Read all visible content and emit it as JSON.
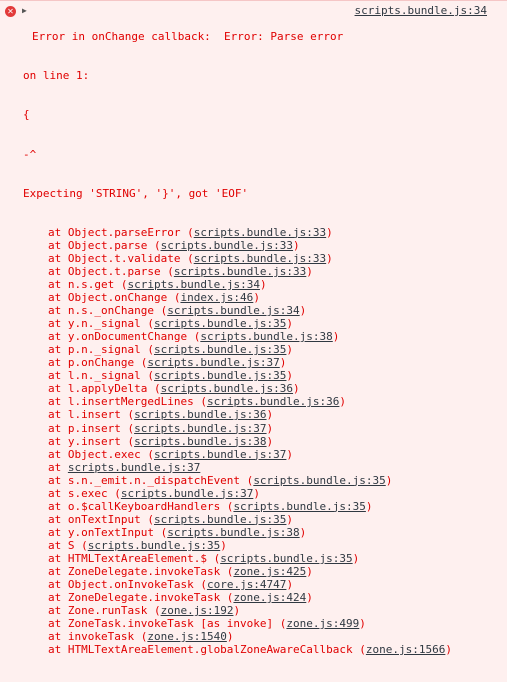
{
  "entry": {
    "icon": "error-icon",
    "expand_icon": "triangle-right-icon",
    "error_title": "Error in onChange callback:  Error: Parse error ",
    "source": "scripts.bundle.js:34",
    "message_lines": [
      "on line 1:",
      "{",
      "-^",
      "Expecting 'STRING', '}', got 'EOF'"
    ],
    "frames": [
      {
        "prefix": "at Object.parseError (",
        "loc": "scripts.bundle.js:33",
        "suffix": ")"
      },
      {
        "prefix": "at Object.parse (",
        "loc": "scripts.bundle.js:33",
        "suffix": ")"
      },
      {
        "prefix": "at Object.t.validate (",
        "loc": "scripts.bundle.js:33",
        "suffix": ")"
      },
      {
        "prefix": "at Object.t.parse (",
        "loc": "scripts.bundle.js:33",
        "suffix": ")"
      },
      {
        "prefix": "at n.s.get (",
        "loc": "scripts.bundle.js:34",
        "suffix": ")"
      },
      {
        "prefix": "at Object.onChange (",
        "loc": "index.js:46",
        "suffix": ")"
      },
      {
        "prefix": "at n.s._onChange (",
        "loc": "scripts.bundle.js:34",
        "suffix": ")"
      },
      {
        "prefix": "at y.n._signal (",
        "loc": "scripts.bundle.js:35",
        "suffix": ")"
      },
      {
        "prefix": "at y.onDocumentChange (",
        "loc": "scripts.bundle.js:38",
        "suffix": ")"
      },
      {
        "prefix": "at p.n._signal (",
        "loc": "scripts.bundle.js:35",
        "suffix": ")"
      },
      {
        "prefix": "at p.onChange (",
        "loc": "scripts.bundle.js:37",
        "suffix": ")"
      },
      {
        "prefix": "at l.n._signal (",
        "loc": "scripts.bundle.js:35",
        "suffix": ")"
      },
      {
        "prefix": "at l.applyDelta (",
        "loc": "scripts.bundle.js:36",
        "suffix": ")"
      },
      {
        "prefix": "at l.insertMergedLines (",
        "loc": "scripts.bundle.js:36",
        "suffix": ")"
      },
      {
        "prefix": "at l.insert (",
        "loc": "scripts.bundle.js:36",
        "suffix": ")"
      },
      {
        "prefix": "at p.insert (",
        "loc": "scripts.bundle.js:37",
        "suffix": ")"
      },
      {
        "prefix": "at y.insert (",
        "loc": "scripts.bundle.js:38",
        "suffix": ")"
      },
      {
        "prefix": "at Object.exec (",
        "loc": "scripts.bundle.js:37",
        "suffix": ")"
      },
      {
        "prefix": "at ",
        "loc": "scripts.bundle.js:37",
        "suffix": ""
      },
      {
        "prefix": "at s.n._emit.n._dispatchEvent (",
        "loc": "scripts.bundle.js:35",
        "suffix": ")"
      },
      {
        "prefix": "at s.exec (",
        "loc": "scripts.bundle.js:37",
        "suffix": ")"
      },
      {
        "prefix": "at o.$callKeyboardHandlers (",
        "loc": "scripts.bundle.js:35",
        "suffix": ")"
      },
      {
        "prefix": "at onTextInput (",
        "loc": "scripts.bundle.js:35",
        "suffix": ")"
      },
      {
        "prefix": "at y.onTextInput (",
        "loc": "scripts.bundle.js:38",
        "suffix": ")"
      },
      {
        "prefix": "at S (",
        "loc": "scripts.bundle.js:35",
        "suffix": ")"
      },
      {
        "prefix": "at HTMLTextAreaElement.$ (",
        "loc": "scripts.bundle.js:35",
        "suffix": ")"
      },
      {
        "prefix": "at ZoneDelegate.invokeTask (",
        "loc": "zone.js:425",
        "suffix": ")"
      },
      {
        "prefix": "at Object.onInvokeTask (",
        "loc": "core.js:4747",
        "suffix": ")"
      },
      {
        "prefix": "at ZoneDelegate.invokeTask (",
        "loc": "zone.js:424",
        "suffix": ")"
      },
      {
        "prefix": "at Zone.runTask (",
        "loc": "zone.js:192",
        "suffix": ")"
      },
      {
        "prefix": "at ZoneTask.invokeTask [as invoke] (",
        "loc": "zone.js:499",
        "suffix": ")"
      },
      {
        "prefix": "at invokeTask (",
        "loc": "zone.js:1540",
        "suffix": ")"
      },
      {
        "prefix": "at HTMLTextAreaElement.globalZoneAwareCallback (",
        "loc": "zone.js:1566",
        "suffix": ")"
      }
    ]
  },
  "colors": {
    "error_text": "#e00000",
    "link_text": "#303942",
    "background": "#fef0ef"
  }
}
